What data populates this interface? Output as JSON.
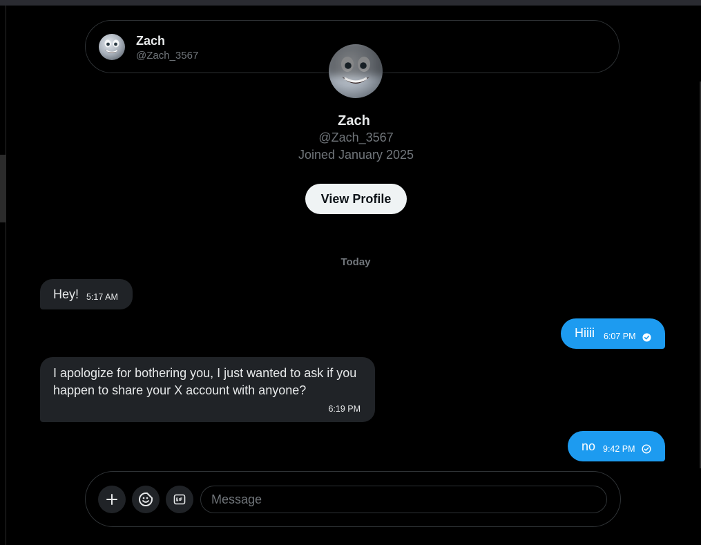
{
  "header": {
    "name": "Zach",
    "handle": "@Zach_3567"
  },
  "profile": {
    "name": "Zach",
    "handle": "@Zach_3567",
    "joined": "Joined January 2025",
    "view_profile_label": "View Profile"
  },
  "date_divider": "Today",
  "messages": [
    {
      "direction": "in",
      "text": "Hey!",
      "time": "5:17 AM"
    },
    {
      "direction": "out",
      "text": "Hiiii",
      "time": "6:07 PM",
      "status": "read"
    },
    {
      "direction": "in",
      "text": "I apologize for bothering you, I just wanted to ask if you happen to share your X account with anyone?",
      "time": "6:19 PM"
    },
    {
      "direction": "out",
      "text": "no",
      "time": "9:42 PM",
      "status": "sent"
    }
  ],
  "composer": {
    "placeholder": "Message",
    "value": ""
  },
  "icons": {
    "avatar": "smiling-face-avatar",
    "add": "plus-icon",
    "emoji": "emoji-icon",
    "gif": "gif-icon",
    "read": "read-check-icon",
    "sent": "sent-check-icon"
  },
  "colors": {
    "accent": "#1d9bf0",
    "incoming_bubble": "#202327",
    "muted": "#71767b",
    "background": "#000000"
  }
}
